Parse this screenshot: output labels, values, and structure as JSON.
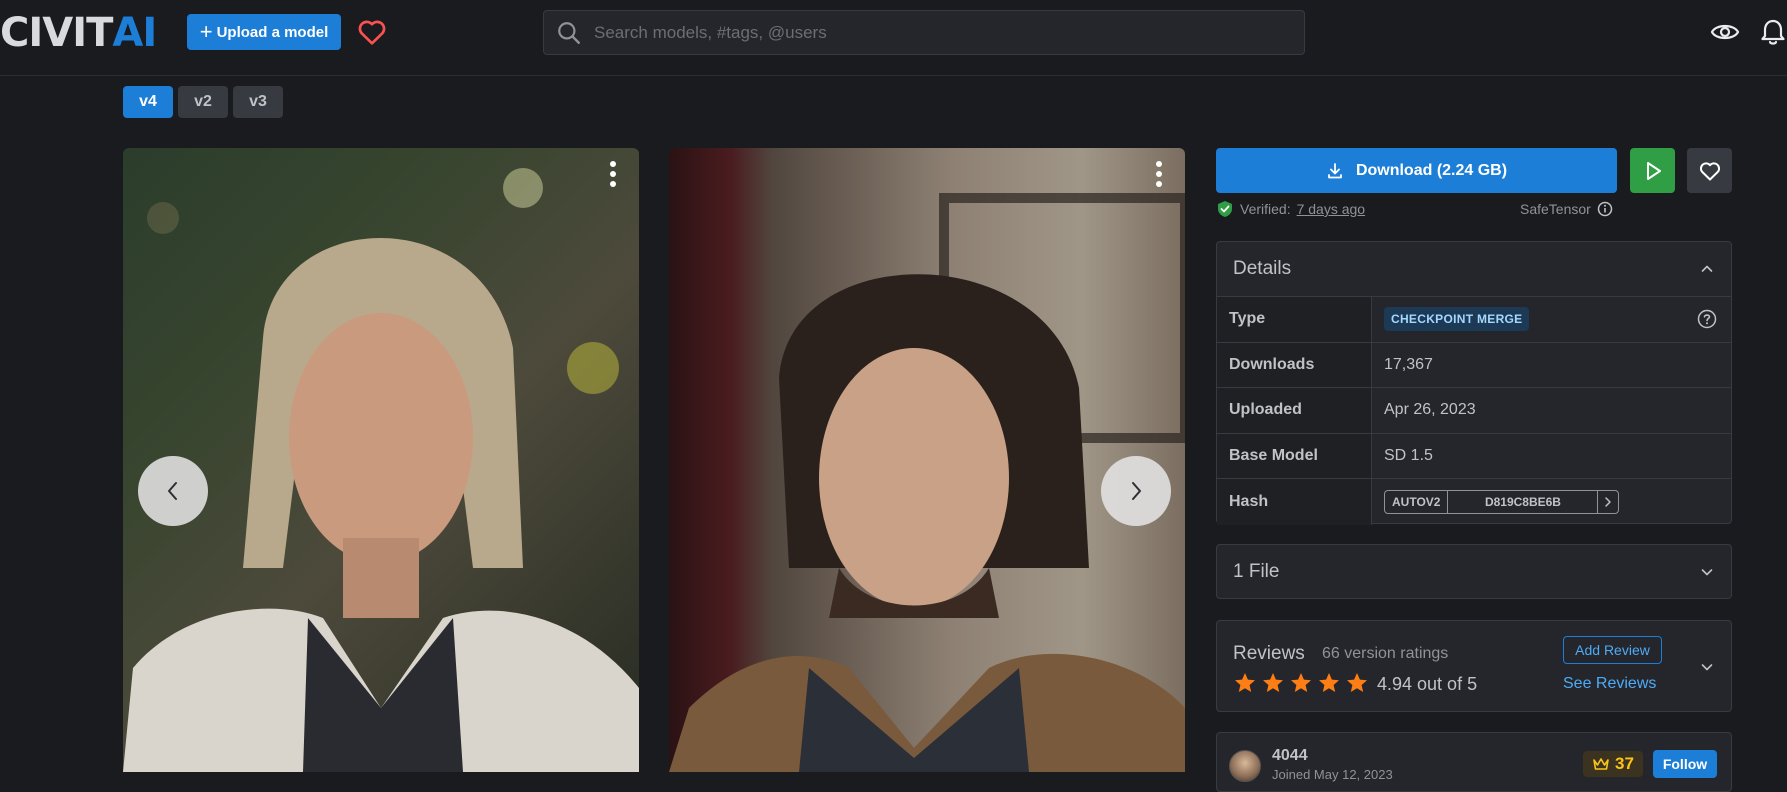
{
  "header": {
    "logo_left": "CIVIT",
    "logo_right": "AI",
    "upload_label": "Upload a model",
    "search_placeholder": "Search models, #tags, @users"
  },
  "versions": [
    {
      "label": "v4",
      "active": true
    },
    {
      "label": "v2",
      "active": false
    },
    {
      "label": "v3",
      "active": false
    }
  ],
  "download": {
    "label": "Download (2.24 GB)",
    "verified_prefix": "Verified:",
    "verified_when": "7 days ago",
    "format": "SafeTensor"
  },
  "details": {
    "title": "Details",
    "rows": {
      "type": {
        "key": "Type",
        "value": "CHECKPOINT MERGE"
      },
      "downloads": {
        "key": "Downloads",
        "value": "17,367"
      },
      "uploaded": {
        "key": "Uploaded",
        "value": "Apr 26, 2023"
      },
      "base_model": {
        "key": "Base Model",
        "value": "SD 1.5"
      },
      "hash": {
        "key": "Hash",
        "algo": "AUTOV2",
        "value": "D819C8BE6B"
      }
    }
  },
  "files": {
    "label": "1 File"
  },
  "reviews": {
    "title": "Reviews",
    "count": "66 version ratings",
    "score": "4.94 out of 5",
    "stars": 5,
    "add_label": "Add Review",
    "see_label": "See Reviews"
  },
  "creator": {
    "name": "4044",
    "joined": "Joined May 12, 2023",
    "crowns": "37",
    "follow_label": "Follow"
  },
  "colors": {
    "accent": "#1c7ed6",
    "play": "#2f9e44",
    "star": "#fd7e14",
    "background": "#1a1b1e"
  }
}
